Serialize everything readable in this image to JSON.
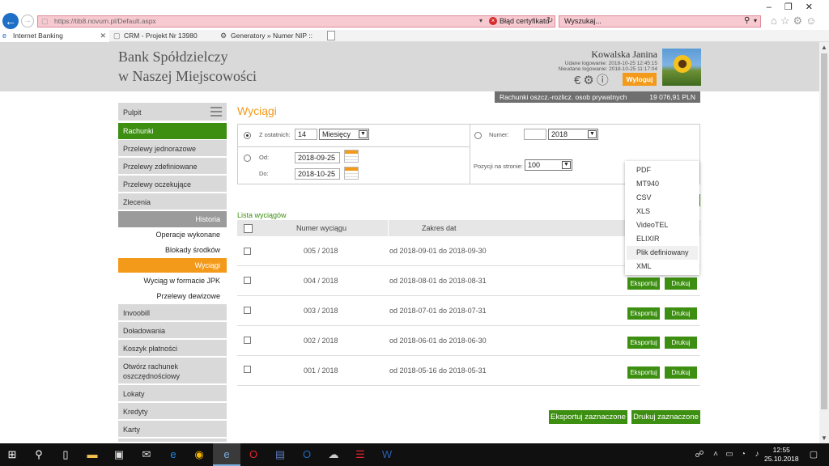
{
  "browser": {
    "url": "https://tib8.novum.pl/Default.aspx",
    "cert_error": "Błąd certyfikatu",
    "search_placeholder": "Wyszukaj...",
    "tabs": [
      {
        "label": "Internet Banking",
        "active": true
      },
      {
        "label": "CRM - Projekt Nr 13980",
        "active": false
      },
      {
        "label": "Generatory » Numer NIP :: GEN...",
        "active": false
      }
    ]
  },
  "header": {
    "bank_line1": "Bank Spółdzielczy",
    "bank_line2": "w Naszej Miejscowości",
    "user_name": "Kowalska Janina",
    "login_ok": "Udane logowanie: 2018-10-25 12:45:15",
    "login_fail": "Nieudane logowanie: 2018-10-25 11:17:04",
    "logout_label": "Wyloguj",
    "account_name": "Rachunki oszcz.-rozlicz. osob prywatnych",
    "account_balance": "19 076,91 PLN"
  },
  "sidebar": {
    "items": [
      {
        "label": "Pulpit"
      },
      {
        "label": "Rachunki"
      },
      {
        "label": "Przelewy jednorazowe"
      },
      {
        "label": "Przelewy zdefiniowane"
      },
      {
        "label": "Przelewy oczekujące"
      },
      {
        "label": "Zlecenia"
      },
      {
        "label": "Historia"
      },
      {
        "label": "Operacje wykonane"
      },
      {
        "label": "Blokady środków"
      },
      {
        "label": "Wyciągi"
      },
      {
        "label": "Wyciąg w formacie JPK"
      },
      {
        "label": "Przelewy dewizowe"
      },
      {
        "label": "Invoobill"
      },
      {
        "label": "Doładowania"
      },
      {
        "label": "Koszyk płatności"
      },
      {
        "label": "Otwórz rachunek oszczędnościowy"
      },
      {
        "label": "Lokaty"
      },
      {
        "label": "Kredyty"
      },
      {
        "label": "Karty"
      }
    ]
  },
  "main": {
    "title": "Wyciągi",
    "filter": {
      "last_label": "Z ostatnich:",
      "last_value": "14",
      "period_value": "Miesięcy",
      "from_label": "Od:",
      "from_value": "2018-09-25",
      "to_label": "Do:",
      "to_value": "2018-10-25",
      "number_label": "Numer:",
      "number_value": "",
      "year_value": "2018",
      "per_page_label": "Pozycji na stronie:",
      "per_page_value": "100"
    },
    "list_title": "Lista wyciągów",
    "columns": [
      "Numer wyciągu",
      "Zakres dat"
    ],
    "rows": [
      {
        "number": "005 / 2018",
        "range": "od 2018-09-01 do 2018-09-30"
      },
      {
        "number": "004 / 2018",
        "range": "od 2018-08-01 do 2018-08-31"
      },
      {
        "number": "003 / 2018",
        "range": "od 2018-07-01 do 2018-07-31"
      },
      {
        "number": "002 / 2018",
        "range": "od 2018-06-01 do 2018-06-30"
      },
      {
        "number": "001 / 2018",
        "range": "od 2018-05-16 do 2018-05-31"
      }
    ],
    "export_label": "Eksportuj",
    "print_label": "Drukuj",
    "export_selected_label": "Eksportuj zaznaczone",
    "print_selected_label": "Drukuj zaznaczone",
    "export_menu": [
      "PDF",
      "MT940",
      "CSV",
      "XLS",
      "VideoTEL",
      "ELIXIR",
      "Plik definiowany",
      "XML"
    ]
  },
  "taskbar": {
    "time": "12:55",
    "date": "25.10.2018"
  },
  "colors": {
    "accent_green": "#3d8f12",
    "accent_orange": "#f39a1a",
    "header_grey": "#d9d9d9"
  }
}
